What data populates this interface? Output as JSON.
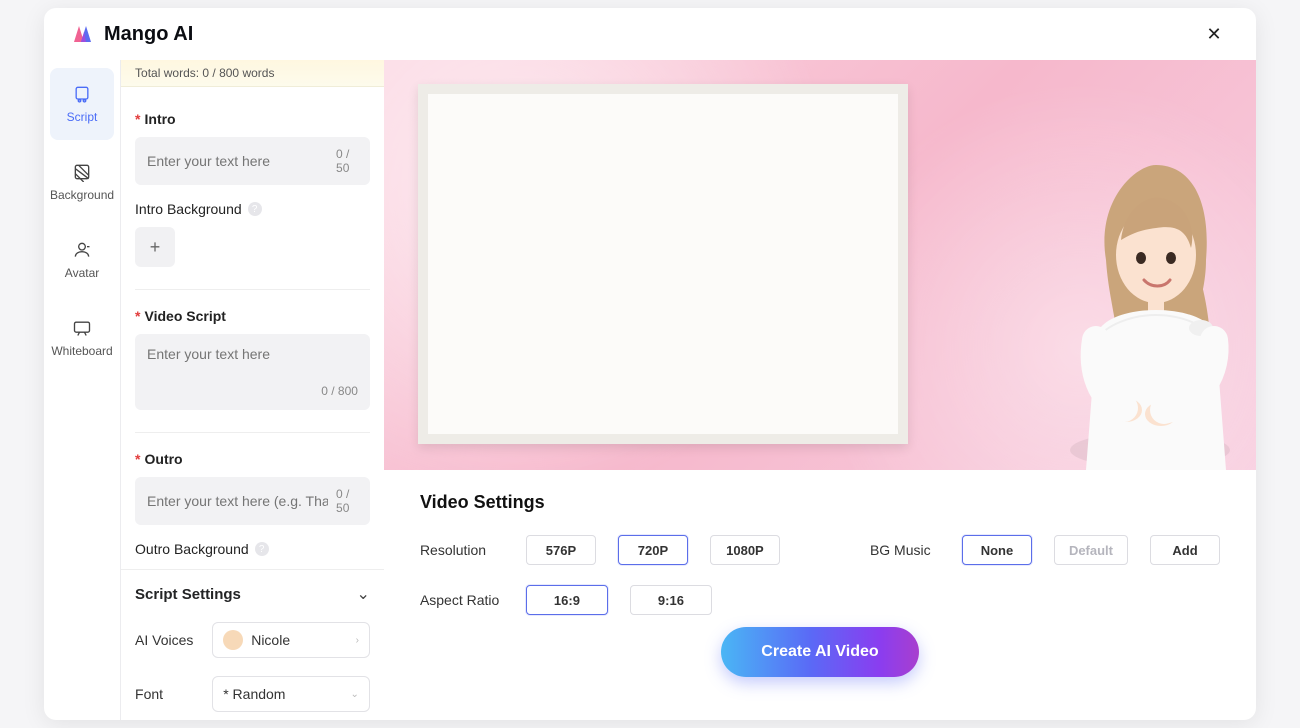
{
  "brand": {
    "name": "Mango AI"
  },
  "sidebar": {
    "items": [
      {
        "label": "Script"
      },
      {
        "label": "Background"
      },
      {
        "label": "Avatar"
      },
      {
        "label": "Whiteboard"
      }
    ]
  },
  "wordbar": {
    "text": "Total words: 0 / 800 words"
  },
  "form": {
    "intro": {
      "label": "Intro",
      "placeholder": "Enter your text here",
      "counter": "0 / 50"
    },
    "intro_bg": {
      "label": "Intro Background"
    },
    "video_script": {
      "label": "Video Script",
      "placeholder": "Enter your text here",
      "counter": "0 / 800"
    },
    "outro": {
      "label": "Outro",
      "placeholder": "Enter your text here (e.g. Thank you!)",
      "counter": "0 / 50"
    },
    "outro_bg": {
      "label": "Outro Background"
    }
  },
  "script_settings": {
    "title": "Script Settings",
    "voices_label": "AI Voices",
    "voice_value": "Nicole",
    "font_label": "Font",
    "font_value": "* Random"
  },
  "video_settings": {
    "title": "Video Settings",
    "resolution": {
      "label": "Resolution",
      "options": [
        "576P",
        "720P",
        "1080P"
      ],
      "selected": "720P"
    },
    "aspect": {
      "label": "Aspect Ratio",
      "options": [
        "16:9",
        "9:16"
      ],
      "selected": "16:9"
    },
    "bgm": {
      "label": "BG Music",
      "options": [
        "None",
        "Default",
        "Add"
      ],
      "selected": "None"
    },
    "create_label": "Create AI Video"
  },
  "icons": {
    "help": "?",
    "plus": "+",
    "chevron_down": "⌄",
    "caret_right": "›",
    "close": "✕"
  }
}
